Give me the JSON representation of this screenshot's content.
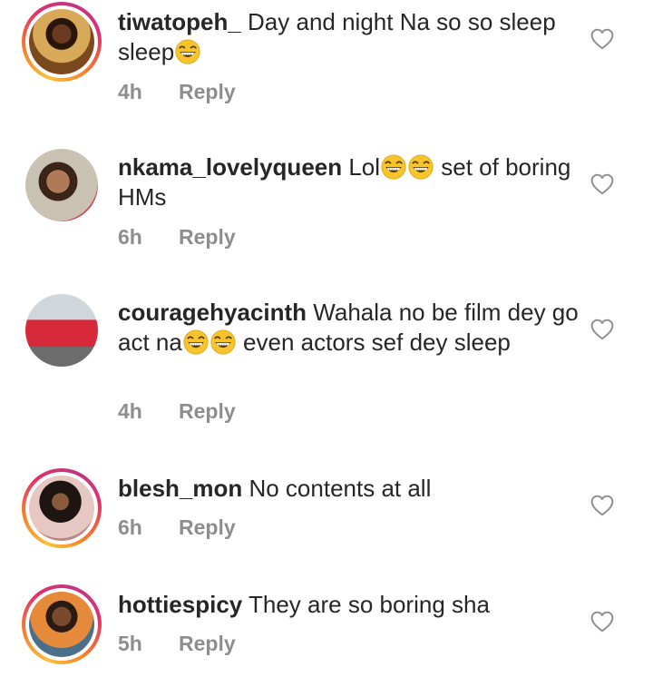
{
  "comments": [
    {
      "username": "tiwatopeh_",
      "text_parts": [
        " Day and night Na so so sleep sleep"
      ],
      "time": "4h",
      "reply_label": "Reply"
    },
    {
      "username": "nkama_lovelyqueen",
      "text_parts": [
        " Lol",
        " set of boring HMs"
      ],
      "time": "6h",
      "reply_label": "Reply"
    },
    {
      "username": "couragehyacinth",
      "text_parts": [
        " Wahala no be film dey go act na",
        " even actors sef dey sleep"
      ],
      "time": "4h",
      "reply_label": "Reply"
    },
    {
      "username": "blesh_mon",
      "text_parts": [
        " No contents at all"
      ],
      "time": "6h",
      "reply_label": "Reply"
    },
    {
      "username": "hottiespicy",
      "text_parts": [
        " They are so boring sha"
      ],
      "time": "5h",
      "reply_label": "Reply"
    }
  ],
  "icons": {
    "like": "heart-outline-icon",
    "emoji": "grinning-squinting-face-icon"
  },
  "colors": {
    "text": "#262626",
    "meta": "#8e8e8e",
    "story_ring_start": "#f9c13b",
    "story_ring_end": "#c13584",
    "emoji_yellow": "#f7c52b"
  }
}
